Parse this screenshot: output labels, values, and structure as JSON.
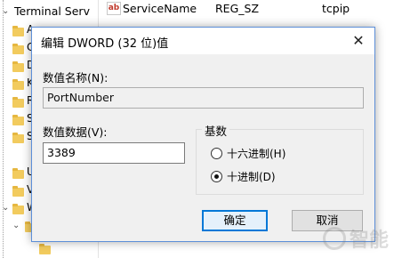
{
  "registry": {
    "tree_item_label": "Terminal Serv",
    "tree_letters": [
      "A",
      "C",
      "D",
      "K",
      "R",
      "S",
      "S",
      "U",
      "V",
      "W"
    ],
    "value_row": {
      "icon": "string-value-icon",
      "icon_text": "ab",
      "name": "ServiceName",
      "type": "REG_SZ",
      "data": "tcpip"
    }
  },
  "dialog": {
    "title": "编辑 DWORD (32 位)值",
    "name_label": "数值名称(N):",
    "name_value": "PortNumber",
    "data_label": "数值数据(V):",
    "data_value": "3389",
    "base_group_label": "基数",
    "radio_hex_label": "十六进制(H)",
    "radio_dec_label": "十进制(D)",
    "selected_base": "decimal",
    "ok_label": "确定",
    "cancel_label": "取消",
    "close_symbol": "✕"
  },
  "watermark": {
    "text": "智能"
  },
  "colors": {
    "accent": "#0078d7",
    "folder": "#f2cb5e",
    "dialog_border": "#5d8fd8"
  }
}
